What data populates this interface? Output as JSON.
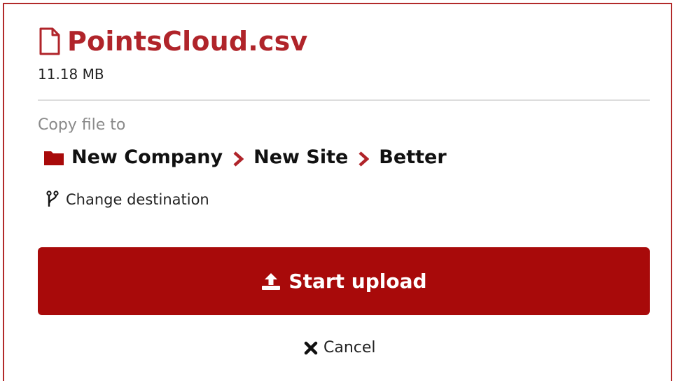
{
  "file": {
    "name": "PointsCloud.csv",
    "size": "11.18 MB",
    "icon": "file-icon"
  },
  "destination": {
    "label": "Copy file to",
    "path": [
      "New Company",
      "New Site",
      "Better"
    ],
    "folder_icon": "folder-icon",
    "separator_icon": "chevron-right-icon",
    "change_label": "Change destination",
    "change_icon": "branch-icon"
  },
  "actions": {
    "upload_label": "Start upload",
    "upload_icon": "upload-icon",
    "cancel_label": "Cancel",
    "cancel_icon": "close-icon"
  },
  "colors": {
    "accent": "#b0242a",
    "button": "#a80a0a",
    "border": "#b22a2a"
  }
}
